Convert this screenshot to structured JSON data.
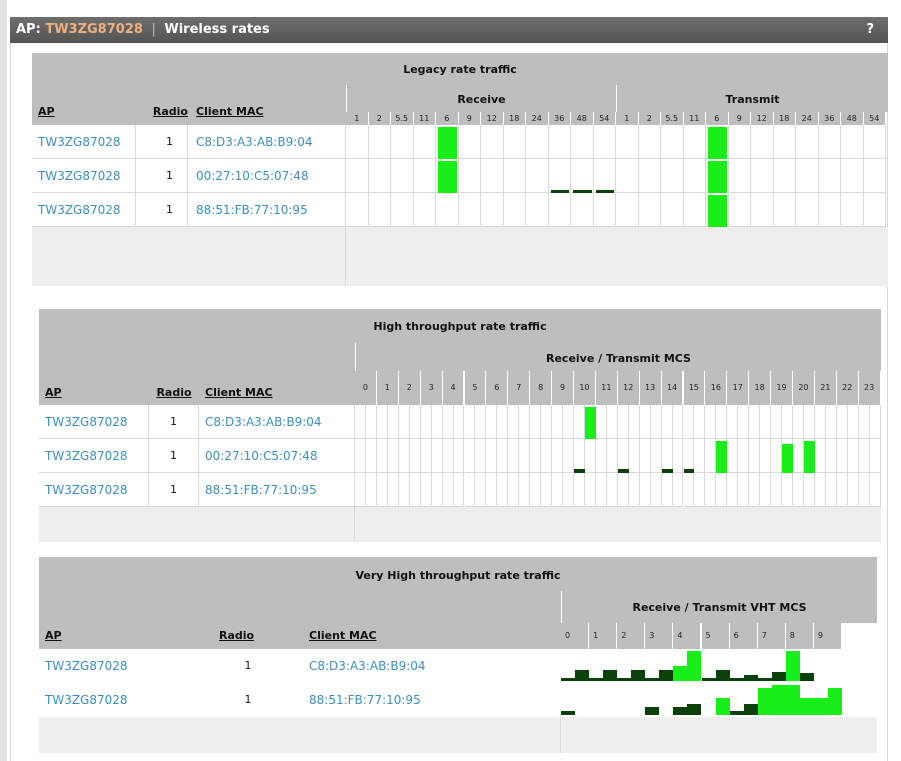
{
  "header": {
    "prefix": "AP:",
    "ap_name": "TW3ZG87028",
    "separator": "|",
    "title": "Wireless rates",
    "help": "?"
  },
  "colors": {
    "bright": "#18ee18",
    "dark": "#0a400a",
    "link": "#3a8fc0"
  },
  "legacy": {
    "title": "Legacy rate traffic",
    "receive_label": "Receive",
    "transmit_label": "Transmit",
    "columns": {
      "ap": "AP",
      "radio": "Radio",
      "mac": "Client MAC"
    },
    "rates": [
      "1",
      "2",
      "5.5",
      "11",
      "6",
      "9",
      "12",
      "18",
      "24",
      "36",
      "48",
      "54"
    ],
    "rows": [
      {
        "ap": "TW3ZG87028",
        "radio": "1",
        "mac": "C8:D3:A3:AB:B9:04",
        "rx": [
          0,
          0,
          0,
          0,
          1,
          0,
          0,
          0,
          0,
          0,
          0,
          0
        ],
        "tx": [
          0,
          0,
          0,
          0,
          1,
          0,
          0,
          0,
          0,
          0,
          0,
          0
        ]
      },
      {
        "ap": "TW3ZG87028",
        "radio": "1",
        "mac": "00:27:10:C5:07:48",
        "rx": [
          0,
          0,
          0,
          0,
          1,
          0,
          0,
          0,
          0,
          0.1,
          0.1,
          0.1
        ],
        "tx": [
          0,
          0,
          0,
          0,
          1,
          0,
          0,
          0,
          0,
          0,
          0,
          0
        ]
      },
      {
        "ap": "TW3ZG87028",
        "radio": "1",
        "mac": "88:51:FB:77:10:95",
        "rx": [
          0,
          0,
          0,
          0,
          0,
          0,
          0,
          0,
          0,
          0,
          0,
          0
        ],
        "tx": [
          0,
          0,
          0,
          0,
          1,
          0,
          0,
          0,
          0,
          0,
          0,
          0
        ]
      }
    ]
  },
  "ht": {
    "title": "High throughput rate traffic",
    "mcs_label": "Receive / Transmit MCS",
    "columns": {
      "ap": "AP",
      "radio": "Radio",
      "mac": "Client MAC"
    },
    "mcs": [
      "0",
      "1",
      "2",
      "3",
      "4",
      "5",
      "6",
      "7",
      "8",
      "9",
      "10",
      "11",
      "12",
      "13",
      "14",
      "15",
      "16",
      "17",
      "18",
      "19",
      "20",
      "21",
      "22",
      "23"
    ],
    "rows": [
      {
        "ap": "TW3ZG87028",
        "radio": "1",
        "mac": "C8:D3:A3:AB:B9:04",
        "levels": [
          [
            0,
            0
          ],
          [
            0,
            0
          ],
          [
            0,
            0
          ],
          [
            0,
            0
          ],
          [
            0,
            0
          ],
          [
            0,
            0
          ],
          [
            0,
            0
          ],
          [
            0,
            0
          ],
          [
            0,
            0
          ],
          [
            0,
            0
          ],
          [
            0,
            1
          ],
          [
            0,
            0
          ],
          [
            0,
            0
          ],
          [
            0,
            0
          ],
          [
            0,
            0
          ],
          [
            0,
            0
          ],
          [
            0,
            0
          ],
          [
            0,
            0
          ],
          [
            0,
            0
          ],
          [
            0,
            0
          ],
          [
            0,
            0
          ],
          [
            0,
            0
          ],
          [
            0,
            0
          ],
          [
            0,
            0
          ]
        ]
      },
      {
        "ap": "TW3ZG87028",
        "radio": "1",
        "mac": "00:27:10:C5:07:48",
        "levels": [
          [
            0,
            0
          ],
          [
            0,
            0
          ],
          [
            0,
            0
          ],
          [
            0,
            0
          ],
          [
            0,
            0
          ],
          [
            0,
            0
          ],
          [
            0,
            0
          ],
          [
            0,
            0
          ],
          [
            0,
            0
          ],
          [
            0,
            0
          ],
          [
            0.12,
            0
          ],
          [
            0,
            0
          ],
          [
            0.12,
            0
          ],
          [
            0,
            0
          ],
          [
            0.12,
            0
          ],
          [
            0.12,
            0
          ],
          [
            0,
            1
          ],
          [
            0,
            0
          ],
          [
            0,
            0
          ],
          [
            0,
            0.9
          ],
          [
            0,
            1
          ],
          [
            0,
            0
          ],
          [
            0,
            0
          ],
          [
            0,
            0
          ]
        ]
      },
      {
        "ap": "TW3ZG87028",
        "radio": "1",
        "mac": "88:51:FB:77:10:95",
        "levels": [
          [
            0,
            0
          ],
          [
            0,
            0
          ],
          [
            0,
            0
          ],
          [
            0,
            0
          ],
          [
            0,
            0
          ],
          [
            0,
            0
          ],
          [
            0,
            0
          ],
          [
            0,
            0
          ],
          [
            0,
            0
          ],
          [
            0,
            0
          ],
          [
            0,
            0
          ],
          [
            0,
            0
          ],
          [
            0,
            0
          ],
          [
            0,
            0
          ],
          [
            0,
            0
          ],
          [
            0,
            0
          ],
          [
            0,
            0
          ],
          [
            0,
            0
          ],
          [
            0,
            0
          ],
          [
            0,
            0
          ],
          [
            0,
            0
          ],
          [
            0,
            0
          ],
          [
            0,
            0
          ],
          [
            0,
            0
          ]
        ]
      }
    ]
  },
  "vht": {
    "title": "Very High throughput rate traffic",
    "mcs_label": "Receive / Transmit VHT MCS",
    "columns": {
      "ap": "AP",
      "radio": "Radio",
      "mac": "Client MAC"
    },
    "mcs": [
      "0",
      "1",
      "2",
      "3",
      "4",
      "5",
      "6",
      "7",
      "8",
      "9"
    ],
    "rows": [
      {
        "ap": "TW3ZG87028",
        "radio": "1",
        "mac": "C8:D3:A3:AB:B9:04",
        "levels": [
          [
            0.1,
            0.35
          ],
          [
            0.1,
            0.35
          ],
          [
            0.1,
            0.35
          ],
          [
            0.1,
            0.35
          ],
          [
            0.5,
            1
          ],
          [
            0.1,
            0.35
          ],
          [
            0.1,
            0.2
          ],
          [
            0.1,
            0.3
          ],
          [
            1,
            0.25
          ],
          [
            0,
            0
          ]
        ]
      },
      {
        "ap": "TW3ZG87028",
        "radio": "1",
        "mac": "88:51:FB:77:10:95",
        "levels": [
          [
            0.12,
            0
          ],
          [
            0,
            0
          ],
          [
            0,
            0
          ],
          [
            0.25,
            0
          ],
          [
            0.25,
            0.35
          ],
          [
            0,
            0.55
          ],
          [
            0.12,
            0.35
          ],
          [
            0.9,
            1
          ],
          [
            1,
            0.55
          ],
          [
            0.55,
            0.9
          ]
        ]
      }
    ]
  }
}
